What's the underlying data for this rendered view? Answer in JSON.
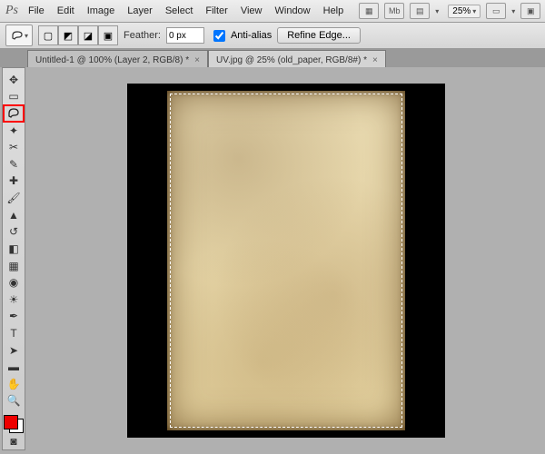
{
  "menu": {
    "items": [
      "File",
      "Edit",
      "Image",
      "Layer",
      "Select",
      "Filter",
      "View",
      "Window",
      "Help"
    ]
  },
  "topbar": {
    "zoom": "25%"
  },
  "options": {
    "feather_label": "Feather:",
    "feather_value": "0 px",
    "antialias_label": "Anti-alias",
    "refine_label": "Refine Edge..."
  },
  "tabs": [
    {
      "label": "Untitled-1 @ 100% (Layer 2, RGB/8) *",
      "active": false
    },
    {
      "label": "UV.jpg @ 25% (old_paper, RGB/8#) *",
      "active": true
    }
  ],
  "tools": {
    "selected": "lasso-tool",
    "foreground_color": "#e00000",
    "background_color": "#ffffff"
  }
}
